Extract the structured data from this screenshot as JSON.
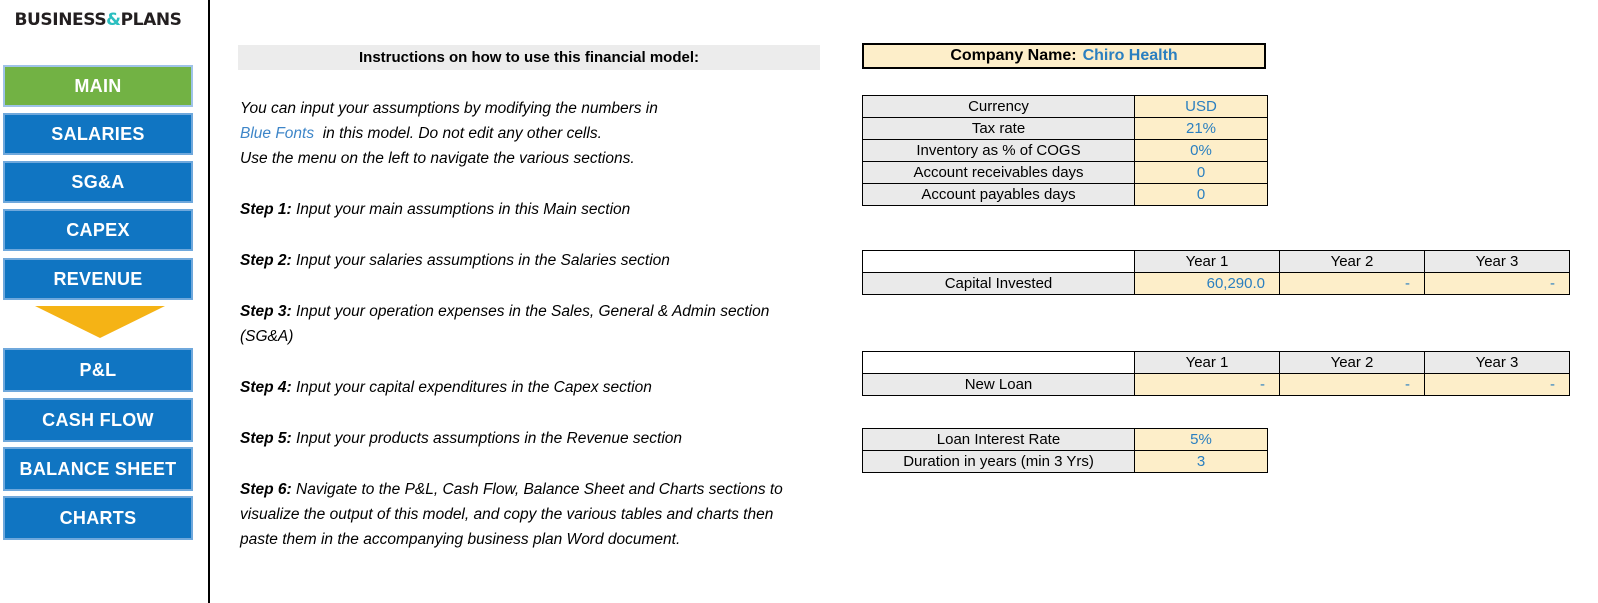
{
  "sidebar": {
    "brand": {
      "pre": "BUSINESS",
      "amp": "&",
      "post": "PLANS"
    },
    "items": [
      {
        "label": "MAIN",
        "active": true
      },
      {
        "label": "SALARIES",
        "active": false
      },
      {
        "label": "SG&A",
        "active": false
      },
      {
        "label": "CAPEX",
        "active": false
      },
      {
        "label": "REVENUE",
        "active": false
      },
      {
        "label": "P&L",
        "active": false
      },
      {
        "label": "CASH FLOW",
        "active": false
      },
      {
        "label": "BALANCE SHEET",
        "active": false
      },
      {
        "label": "CHARTS",
        "active": false
      }
    ],
    "colors": {
      "active": "#72b244",
      "inactive": "#1075c2",
      "arrow": "#f5b315",
      "brand_accent": "#2bbfc0"
    }
  },
  "instructions": {
    "header": "Instructions on how to use this financial model:",
    "intro_line_1a": "You can input your assumptions by modifying the numbers in",
    "intro_line_2_blue": "Blue Fonts",
    "intro_line_2b": "in this model. Do not edit any other cells.",
    "intro_line_3": "Use the menu on the left to navigate the various sections.",
    "steps": [
      {
        "label": "Step 1:",
        "text": "Input your main assumptions in this Main section"
      },
      {
        "label": "Step 2:",
        "text": "Input your salaries assumptions in the Salaries section"
      },
      {
        "label": "Step 3:",
        "text": "Input your operation expenses in the Sales, General & Admin section (SG&A)"
      },
      {
        "label": "Step 4:",
        "text": "Input your capital expenditures in the Capex section"
      },
      {
        "label": "Step 5:",
        "text": "Input your products assumptions in the Revenue section"
      },
      {
        "label": "Step 6:",
        "text": "Navigate to the P&L, Cash Flow, Balance Sheet and Charts sections to visualize the output of this model, and copy the various tables and charts then paste them in the accompanying business plan Word document."
      }
    ]
  },
  "company": {
    "label": "Company Name:",
    "name": "Chiro Health"
  },
  "params": {
    "rows": [
      {
        "label": "Currency",
        "value": "USD"
      },
      {
        "label": "Tax rate",
        "value": "21%"
      },
      {
        "label": "Inventory as % of COGS",
        "value": "0%"
      },
      {
        "label": "Account receivables days",
        "value": "0"
      },
      {
        "label": "Account payables days",
        "value": "0"
      }
    ]
  },
  "capital": {
    "years": [
      "Year 1",
      "Year 2",
      "Year 3"
    ],
    "row_label": "Capital Invested",
    "values": [
      "60,290.0",
      "-",
      "-"
    ]
  },
  "loan": {
    "years": [
      "Year 1",
      "Year 2",
      "Year 3"
    ],
    "row_label": "New Loan",
    "values": [
      "-",
      "-",
      "-"
    ]
  },
  "loan_terms": {
    "rows": [
      {
        "label": "Loan Interest Rate",
        "value": "5%"
      },
      {
        "label": "Duration in years (min 3 Yrs)",
        "value": "3"
      }
    ]
  }
}
